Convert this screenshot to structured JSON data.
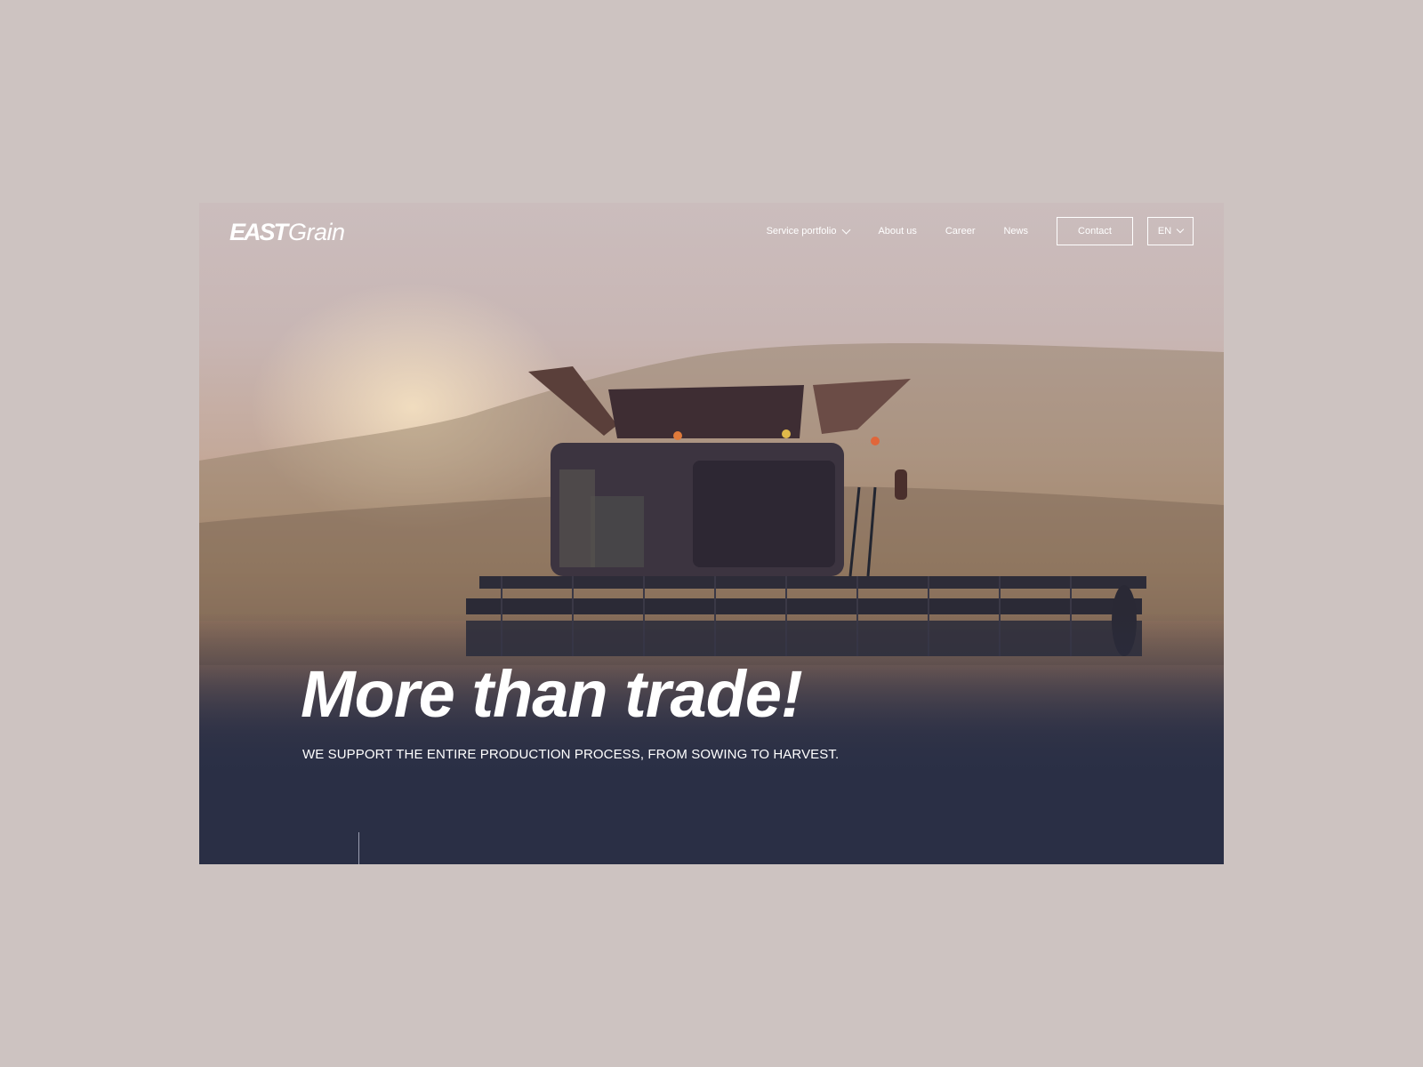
{
  "brand": {
    "logo_part1": "EAST",
    "logo_part2": "Grain"
  },
  "nav": {
    "items": [
      {
        "label": "Service portfolio",
        "has_dropdown": true
      },
      {
        "label": "About us"
      },
      {
        "label": "Career"
      },
      {
        "label": "News"
      }
    ],
    "contact_label": "Contact",
    "language": "EN"
  },
  "hero": {
    "title": "More than trade!",
    "subtitle": "WE SUPPORT THE ENTIRE PRODUCTION PROCESS, FROM SOWING TO HARVEST.",
    "image_icon": "combine-harvester-icon"
  },
  "colors": {
    "page_background": "#cdc3c1",
    "hero_dark": "#2a2f45",
    "text": "#ffffff"
  }
}
